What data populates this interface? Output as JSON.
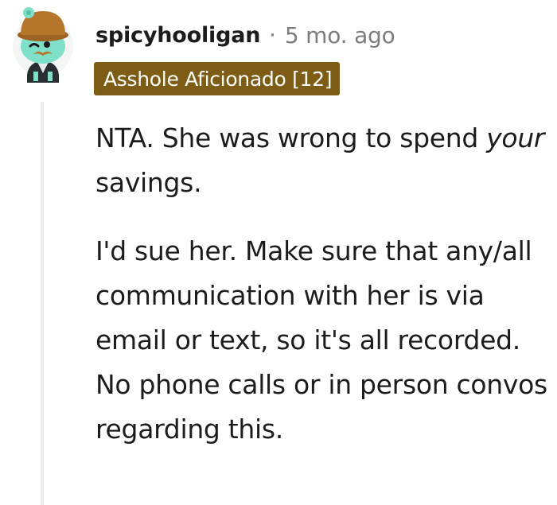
{
  "comment": {
    "username": "spicyhooligan",
    "separator": "·",
    "timestamp": "5 mo. ago",
    "flair": "Asshole Aficionado [12]",
    "paragraphs": [
      {
        "before": "NTA. She was wrong to spend ",
        "emphasis": "your",
        "after": " savings."
      },
      {
        "text": "I'd sue her. Make sure that any/all communication with her is via email or text, so it's all recorded. No phone calls or in person convos regarding this."
      }
    ]
  },
  "colors": {
    "flair_background": "#7d5d15",
    "flair_text": "#ffffff",
    "username": "#1c1c1c",
    "timestamp": "#7c7c7c",
    "thread_line": "#ececec",
    "avatar_skin": "#7fe0c8",
    "avatar_hat": "#b5762c"
  },
  "icons": {
    "avatar": "snoo-avatar-icon"
  }
}
